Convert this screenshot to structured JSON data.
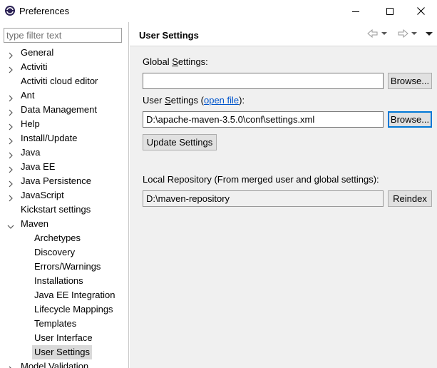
{
  "window": {
    "title": "Preferences",
    "minimize_icon": "minimize-icon",
    "maximize_icon": "maximize-icon",
    "close_icon": "close-icon"
  },
  "filter": {
    "placeholder": "type filter text"
  },
  "tree": {
    "items": [
      {
        "label": "General",
        "level": 0,
        "expandable": true,
        "expanded": false
      },
      {
        "label": "Activiti",
        "level": 0,
        "expandable": true,
        "expanded": false
      },
      {
        "label": "Activiti cloud editor",
        "level": 0,
        "expandable": false
      },
      {
        "label": "Ant",
        "level": 0,
        "expandable": true,
        "expanded": false
      },
      {
        "label": "Data Management",
        "level": 0,
        "expandable": true,
        "expanded": false
      },
      {
        "label": "Help",
        "level": 0,
        "expandable": true,
        "expanded": false
      },
      {
        "label": "Install/Update",
        "level": 0,
        "expandable": true,
        "expanded": false
      },
      {
        "label": "Java",
        "level": 0,
        "expandable": true,
        "expanded": false
      },
      {
        "label": "Java EE",
        "level": 0,
        "expandable": true,
        "expanded": false
      },
      {
        "label": "Java Persistence",
        "level": 0,
        "expandable": true,
        "expanded": false
      },
      {
        "label": "JavaScript",
        "level": 0,
        "expandable": true,
        "expanded": false
      },
      {
        "label": "Kickstart settings",
        "level": 0,
        "expandable": false
      },
      {
        "label": "Maven",
        "level": 0,
        "expandable": true,
        "expanded": true
      },
      {
        "label": "Archetypes",
        "level": 1,
        "expandable": false
      },
      {
        "label": "Discovery",
        "level": 1,
        "expandable": false
      },
      {
        "label": "Errors/Warnings",
        "level": 1,
        "expandable": false
      },
      {
        "label": "Installations",
        "level": 1,
        "expandable": false
      },
      {
        "label": "Java EE Integration",
        "level": 1,
        "expandable": false
      },
      {
        "label": "Lifecycle Mappings",
        "level": 1,
        "expandable": false
      },
      {
        "label": "Templates",
        "level": 1,
        "expandable": false
      },
      {
        "label": "User Interface",
        "level": 1,
        "expandable": false
      },
      {
        "label": "User Settings",
        "level": 1,
        "expandable": false,
        "selected": true
      },
      {
        "label": "Model Validation",
        "level": 0,
        "expandable": true,
        "expanded": false
      }
    ]
  },
  "page": {
    "title": "User Settings",
    "nav": {
      "back_icon": "back-arrow-icon",
      "back_menu_icon": "dropdown-icon",
      "forward_icon": "forward-arrow-icon",
      "forward_menu_icon": "dropdown-icon",
      "view_menu_icon": "view-menu-icon"
    },
    "global_settings": {
      "label_pre": "Global ",
      "label_mnemonic": "S",
      "label_post": "ettings:",
      "value": "",
      "browse_label": "Browse..."
    },
    "user_settings": {
      "label_pre": "User ",
      "label_mnemonic": "S",
      "label_post": "ettings (",
      "link_text": "open file",
      "label_end": "):",
      "value": "D:\\apache-maven-3.5.0\\conf\\settings.xml",
      "browse_label": "Browse..."
    },
    "update_settings_label": "Update Settings",
    "local_repository": {
      "label": "Local Repository (From merged user and global settings):",
      "value": "D:\\maven-repository",
      "reindex_label": "Reindex"
    }
  },
  "colors": {
    "link": "#0055cc",
    "focus": "#0078d7",
    "pane_background": "#f0f0f0",
    "selection": "#d9d9d9"
  }
}
